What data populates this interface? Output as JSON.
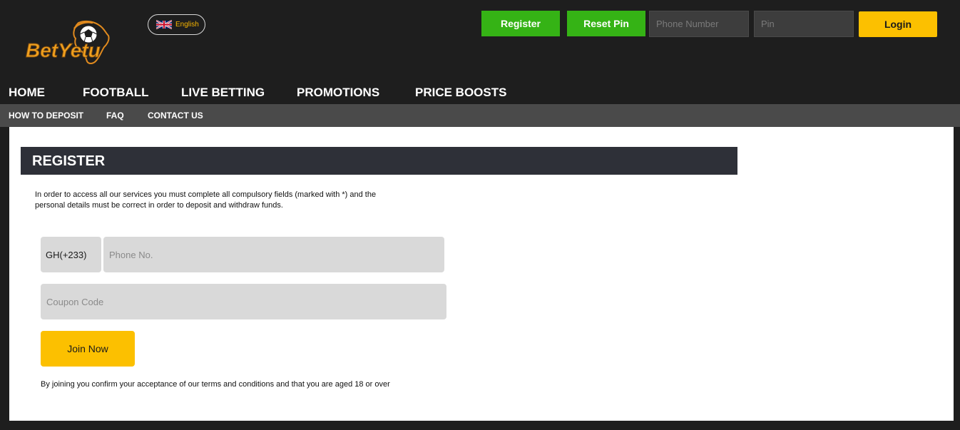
{
  "header": {
    "logo_text": "BetYetu",
    "language": {
      "label": "English",
      "flag_icon": "uk-flag-icon"
    },
    "register_label": "Register",
    "reset_pin_label": "Reset Pin",
    "phone_placeholder": "Phone Number",
    "pin_placeholder": "Pin",
    "login_label": "Login"
  },
  "main_nav": [
    {
      "label": "HOME"
    },
    {
      "label": "FOOTBALL"
    },
    {
      "label": "LIVE BETTING"
    },
    {
      "label": "PROMOTIONS"
    },
    {
      "label": "PRICE BOOSTS"
    }
  ],
  "sub_nav": [
    {
      "label": "HOW TO DEPOSIT"
    },
    {
      "label": "FAQ"
    },
    {
      "label": "CONTACT US"
    }
  ],
  "register": {
    "title": "REGISTER",
    "intro_line1": "In order to access all our services you must complete all compulsory fields (marked with *) and the",
    "intro_line2": "personal details must be correct in order to deposit and withdraw funds.",
    "country_code": "GH(+233)",
    "phone_placeholder": "Phone No.",
    "coupon_placeholder": "Coupon Code",
    "join_label": "Join Now",
    "terms": "By joining you confirm your acceptance of our terms and conditions and that you are aged 18 or over"
  },
  "colors": {
    "background": "#1e1e1e",
    "green": "#35b315",
    "yellow": "#fcc000",
    "subnav": "#4a4a4a",
    "register_bar": "#2e3038",
    "field": "#d9d9d9"
  }
}
